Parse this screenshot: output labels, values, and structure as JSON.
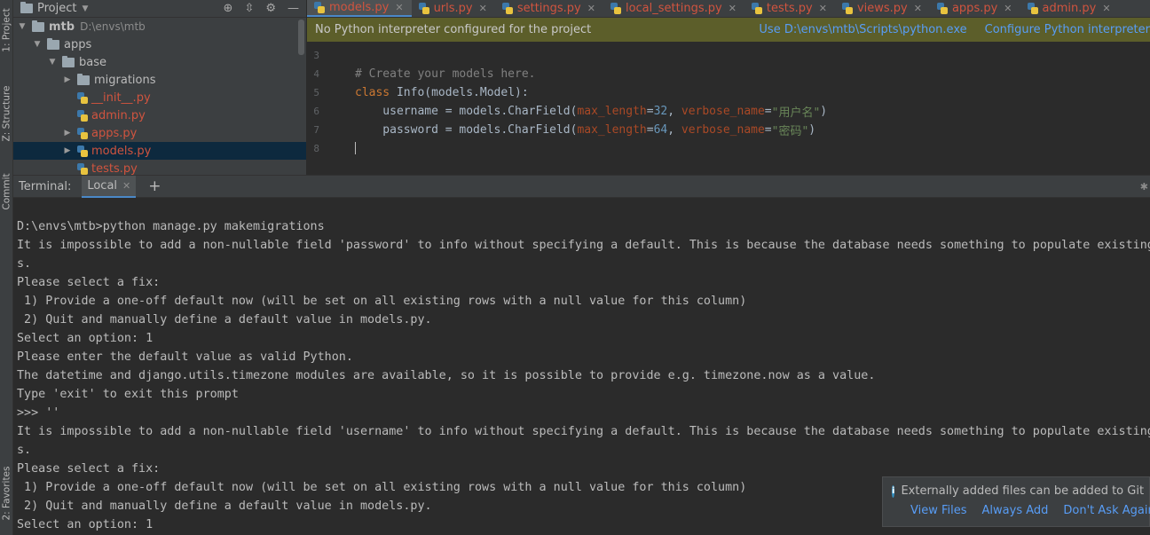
{
  "side_strip": {
    "project": "1: Project",
    "structure": "Z: Structure",
    "commit": "Commit",
    "favorites": "2: Favorites"
  },
  "project_panel": {
    "title": "Project",
    "tree": [
      {
        "name": "mtb",
        "hint": "D:\\envs\\mtb"
      },
      {
        "name": "apps"
      },
      {
        "name": "base"
      },
      {
        "name": "migrations"
      },
      {
        "name": "__init__.py"
      },
      {
        "name": "admin.py"
      },
      {
        "name": "apps.py"
      },
      {
        "name": "models.py"
      },
      {
        "name": "tests.py"
      }
    ]
  },
  "editor": {
    "tabs": [
      {
        "label": "models.py"
      },
      {
        "label": "urls.py"
      },
      {
        "label": "settings.py"
      },
      {
        "label": "local_settings.py"
      },
      {
        "label": "tests.py"
      },
      {
        "label": "views.py"
      },
      {
        "label": "apps.py"
      },
      {
        "label": "admin.py"
      }
    ],
    "notice": {
      "text": "No Python interpreter configured for the project",
      "action_use": "Use D:\\envs\\mtb\\Scripts\\python.exe",
      "action_configure": "Configure Python interpreter"
    },
    "line_numbers": [
      "3",
      "4",
      "5",
      "6",
      "7",
      "8"
    ],
    "code": {
      "comment": "# Create your models here.",
      "kw_class": "class",
      "class_decl": " Info(models.Model):",
      "l6_a": "    username = models.CharField(",
      "l6_p1": "max_length",
      "l6_eq1": "=",
      "l6_n1": "32",
      "l6_sep": ", ",
      "l6_p2": "verbose_name",
      "l6_eq2": "=",
      "l6_s": "\"用户名\"",
      "l6_end": ")",
      "l7_a": "    password = models.CharField(",
      "l7_p1": "max_length",
      "l7_eq1": "=",
      "l7_n1": "64",
      "l7_sep": ", ",
      "l7_p2": "verbose_name",
      "l7_eq2": "=",
      "l7_s": "\"密码\"",
      "l7_end": ")"
    }
  },
  "terminal": {
    "title": "Terminal:",
    "tab": "Local",
    "lines": [
      "D:\\envs\\mtb>python manage.py makemigrations",
      "It is impossible to add a non-nullable field 'password' to info without specifying a default. This is because the database needs something to populate existing row",
      "s.",
      "Please select a fix:",
      " 1) Provide a one-off default now (will be set on all existing rows with a null value for this column)",
      " 2) Quit and manually define a default value in models.py.",
      "Select an option: 1",
      "Please enter the default value as valid Python.",
      "The datetime and django.utils.timezone modules are available, so it is possible to provide e.g. timezone.now as a value.",
      "Type 'exit' to exit this prompt",
      ">>> ''",
      "It is impossible to add a non-nullable field 'username' to info without specifying a default. This is because the database needs something to populate existing row",
      "s.",
      "Please select a fix:",
      " 1) Provide a one-off default now (will be set on all existing rows with a null value for this column)",
      " 2) Quit and manually define a default value in models.py.",
      "Select an option: 1"
    ]
  },
  "notification": {
    "message": "Externally added files can be added to Git",
    "view_files": "View Files",
    "always_add": "Always Add",
    "dont_ask": "Don't Ask Again"
  }
}
